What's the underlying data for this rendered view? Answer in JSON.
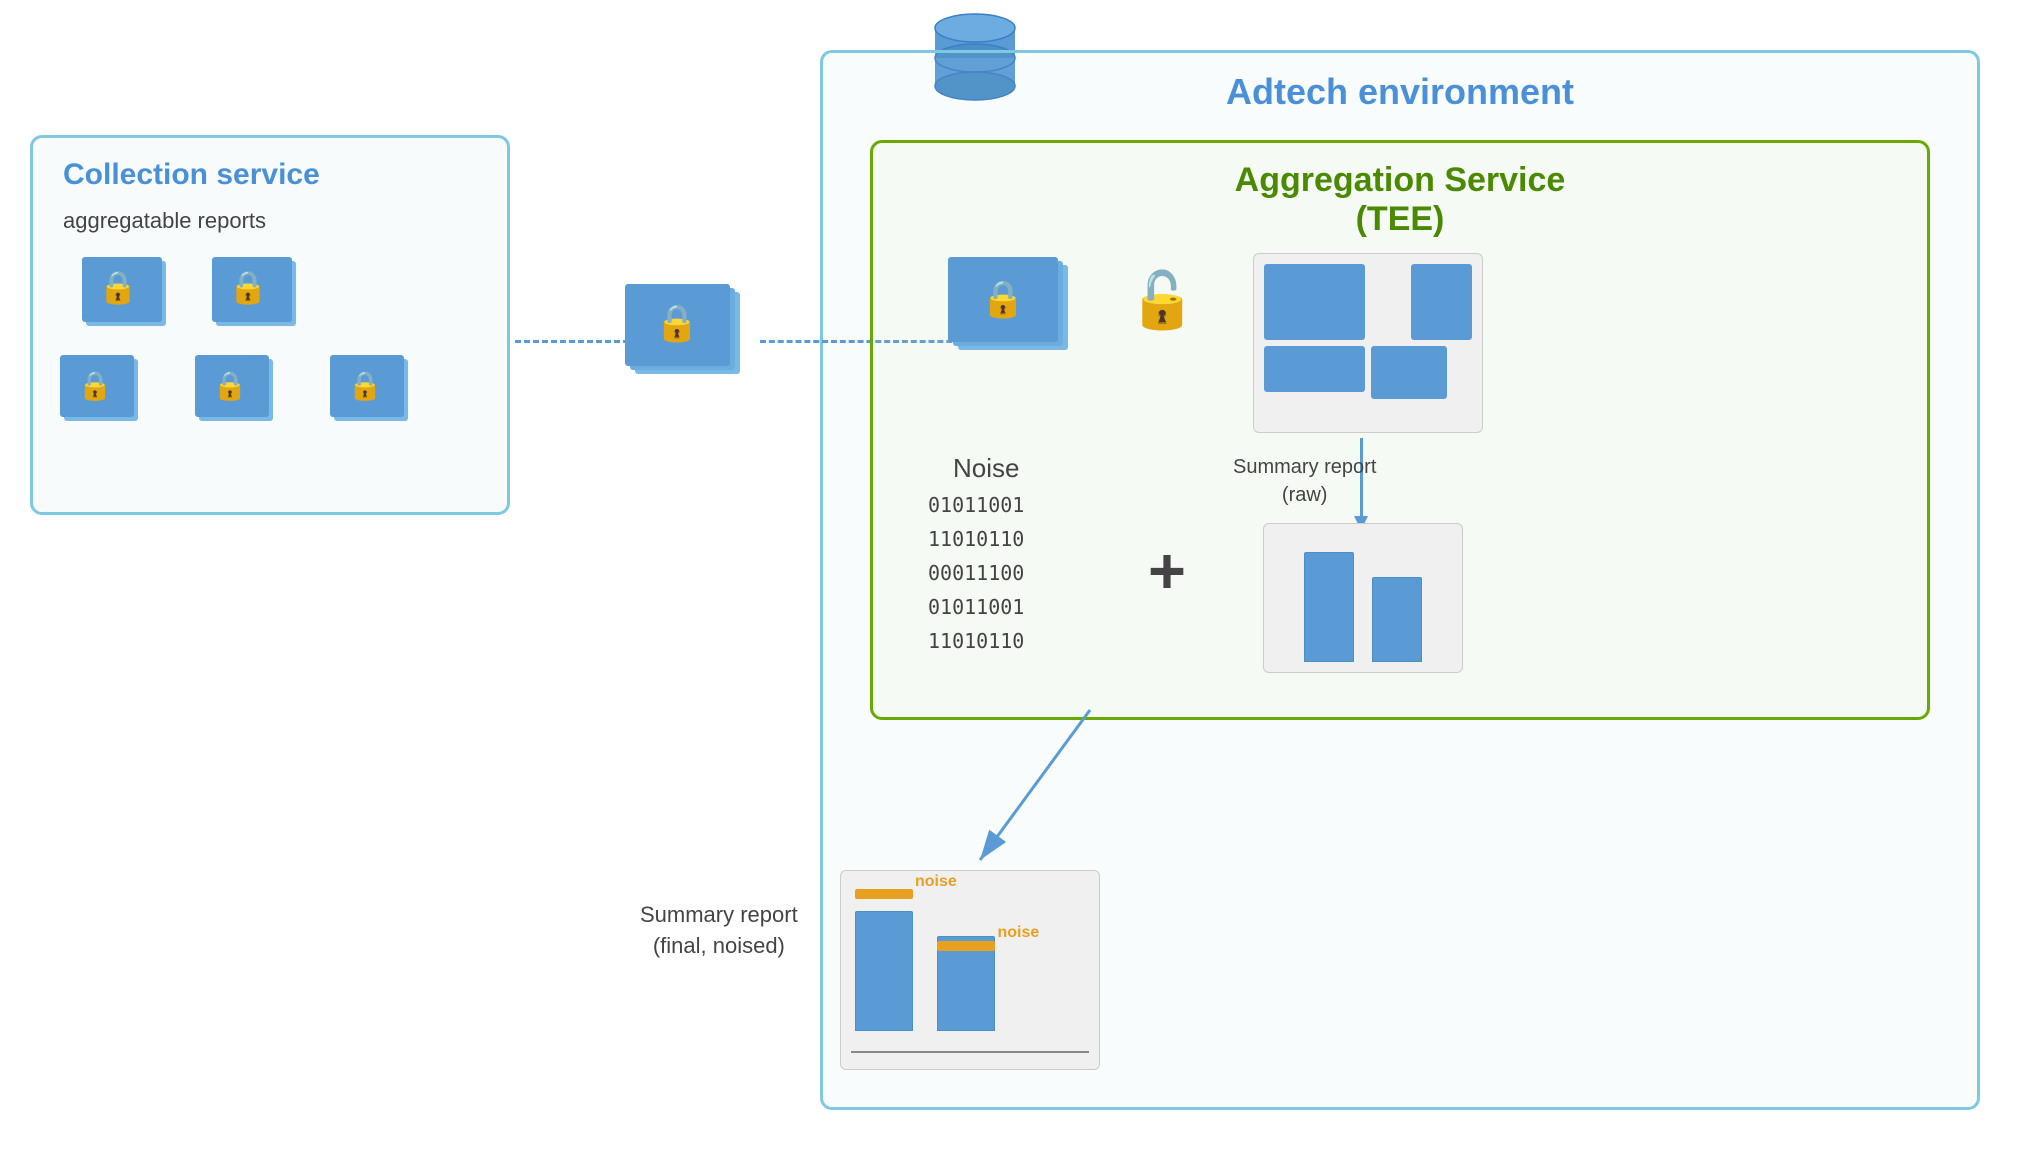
{
  "adtech": {
    "label": "Adtech environment"
  },
  "collection": {
    "label": "Collection service",
    "sublabel": "aggregatable reports"
  },
  "aggregation": {
    "label": "Aggregation Service",
    "label2": "(TEE)"
  },
  "noise": {
    "label": "Noise",
    "lines": [
      "01011001",
      "11010110",
      "00011100",
      "01011001",
      "11010110"
    ]
  },
  "summaryRaw": {
    "label": "Summary report",
    "label2": "(raw)"
  },
  "summaryFinal": {
    "label": "Summary report",
    "label2": "(final, noised)"
  },
  "noiseLabels": [
    "noise",
    "noise"
  ]
}
